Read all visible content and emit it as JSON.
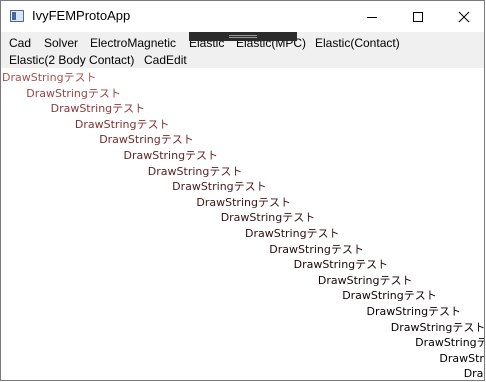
{
  "window": {
    "title": "IvyFEMProtoApp"
  },
  "menu": {
    "row1": [
      "Cad",
      "Solver",
      "ElectroMagnetic",
      "Elastic",
      "Elastic(MPC)",
      "Elastic(Contact)"
    ],
    "row2": [
      "Elastic(2 Body Contact)",
      "CadEdit"
    ]
  },
  "drawstrings": [
    {
      "text": "DrawStringテスト",
      "color": "#a85050"
    },
    {
      "text": "DrawStringテスト",
      "color": "#9a4444"
    },
    {
      "text": "DrawStringテスト",
      "color": "#8c3a3a"
    },
    {
      "text": "DrawStringテスト",
      "color": "#7e3232"
    },
    {
      "text": "DrawStringテスト",
      "color": "#702a2a"
    },
    {
      "text": "DrawStringテスト",
      "color": "#622424"
    },
    {
      "text": "DrawStringテスト",
      "color": "#561e1e"
    },
    {
      "text": "DrawStringテスト",
      "color": "#4a1a1a"
    },
    {
      "text": "DrawStringテスト",
      "color": "#3e1616"
    },
    {
      "text": "DrawStringテスト",
      "color": "#341212"
    },
    {
      "text": "DrawStringテスト",
      "color": "#2c0f0f"
    },
    {
      "text": "DrawStringテスト",
      "color": "#240c0c"
    },
    {
      "text": "DrawStringテスト",
      "color": "#1c0909"
    },
    {
      "text": "DrawStringテスト",
      "color": "#160707"
    },
    {
      "text": "DrawStringテスト",
      "color": "#110505"
    },
    {
      "text": "DrawStringテスト",
      "color": "#0c0303"
    },
    {
      "text": "DrawStringテスト",
      "color": "#080202"
    },
    {
      "text": "DrawStringテスト",
      "color": "#040101"
    },
    {
      "text": "DrawStringテスト",
      "color": "#020000"
    },
    {
      "text": "DrawStringテスト",
      "color": "#000000"
    }
  ]
}
